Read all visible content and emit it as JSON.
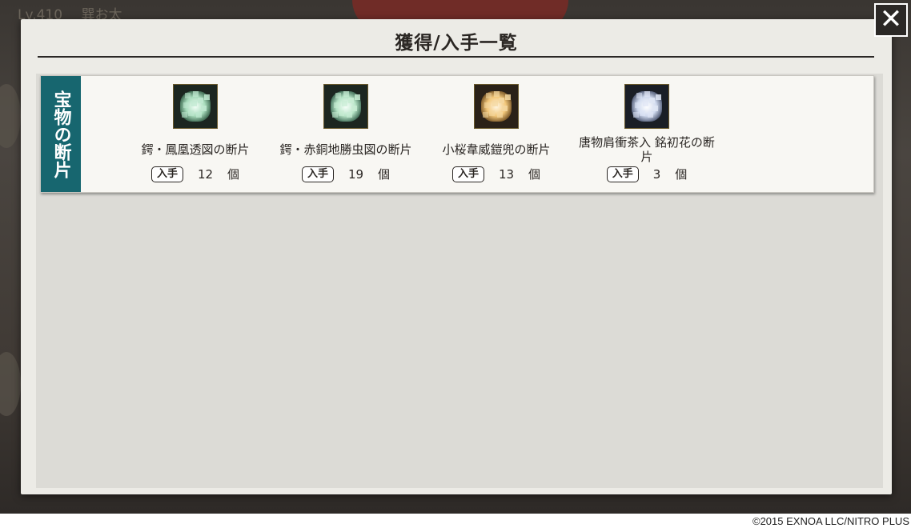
{
  "background": {
    "level_text": "Lv.410",
    "player_name": "巽お太"
  },
  "dialog": {
    "title": "獲得/入手一覧",
    "close_icon": "close-icon"
  },
  "category": {
    "label": "宝物の断片",
    "items": [
      {
        "name": "鍔・鳳凰透図の断片",
        "badge": "入手",
        "count": "12",
        "unit": "個",
        "icon": "green-fragment-icon",
        "color": "#bfe8d0"
      },
      {
        "name": "鍔・赤銅地勝虫図の断片",
        "badge": "入手",
        "count": "19",
        "unit": "個",
        "icon": "green-fragment-icon",
        "color": "#c8ecd4"
      },
      {
        "name": "小桜韋威鎧兜の断片",
        "badge": "入手",
        "count": "13",
        "unit": "個",
        "icon": "gold-fragment-icon",
        "color": "#f3d7a0"
      },
      {
        "name": "唐物肩衝茶入 銘初花の断片",
        "badge": "入手",
        "count": "3",
        "unit": "個",
        "icon": "blue-fragment-icon",
        "color": "#dfe6f5"
      }
    ]
  },
  "footer": {
    "copyright": "©2015 EXNOA LLC/NITRO PLUS"
  },
  "colors": {
    "category_bg": "#17666f",
    "modal_bg": "#ecebe6",
    "content_bg": "#dcdbd6"
  }
}
